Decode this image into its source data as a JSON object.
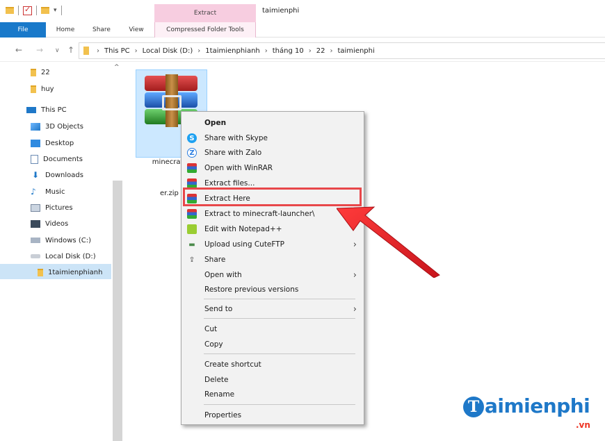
{
  "window": {
    "ribbon_context_header": "Extract",
    "title": "taimienphi"
  },
  "ribbon": {
    "tabs": [
      "File",
      "Home",
      "Share",
      "View",
      "Compressed Folder Tools"
    ]
  },
  "address": {
    "breadcrumb": [
      "This PC",
      "Local Disk (D:)",
      "1taimienphianh",
      "tháng 10",
      "22",
      "taimienphi"
    ]
  },
  "nav_pane": {
    "items": [
      "22",
      "huy",
      "This PC",
      "3D Objects",
      "Desktop",
      "Documents",
      "Downloads",
      "Music",
      "Pictures",
      "Videos",
      "Windows (C:)",
      "Local Disk (D:)",
      "1taimienphianh"
    ],
    "selected": "1taimienphianh"
  },
  "file": {
    "name_line1": "minecraft-l",
    "name_line2": "er.zip",
    "icon": "winrar-archive-icon"
  },
  "context_menu": {
    "items": [
      {
        "label": "Open",
        "icon": "",
        "bold": true
      },
      {
        "label": "Share with Skype",
        "icon": "skype-icon"
      },
      {
        "label": "Share with Zalo",
        "icon": "zalo-icon"
      },
      {
        "label": "Open with WinRAR",
        "icon": "winrar-icon"
      },
      {
        "label": "Extract files...",
        "icon": "winrar-icon"
      },
      {
        "label": "Extract Here",
        "icon": "winrar-icon",
        "highlighted": true
      },
      {
        "label": "Extract to minecraft-launcher\\",
        "icon": "winrar-icon"
      },
      {
        "label": "Edit with Notepad++",
        "icon": "notepadpp-icon"
      },
      {
        "label": "Upload using CuteFTP",
        "icon": "cuteftp-icon",
        "submenu": true
      },
      {
        "label": "Share",
        "icon": "share-icon"
      },
      {
        "label": "Open with",
        "icon": "",
        "submenu": true
      },
      {
        "label": "Restore previous versions",
        "icon": ""
      },
      {
        "label": "Send to",
        "icon": "",
        "submenu": true
      },
      {
        "label": "Cut",
        "icon": ""
      },
      {
        "label": "Copy",
        "icon": ""
      },
      {
        "label": "Create shortcut",
        "icon": ""
      },
      {
        "label": "Delete",
        "icon": ""
      },
      {
        "label": "Rename",
        "icon": ""
      },
      {
        "label": "Properties",
        "icon": ""
      }
    ]
  },
  "annotation": {
    "highlight_color": "#e8474a",
    "arrow_color": "#e8202a"
  },
  "watermark": {
    "logo_letter": "T",
    "text": "aimienphi",
    "suffix": ".vn"
  }
}
